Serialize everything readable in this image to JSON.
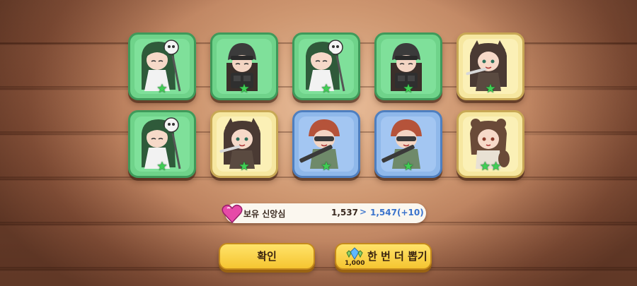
{
  "cards": [
    {
      "character": "skull-hat-girl",
      "frame": "green",
      "stars": "★"
    },
    {
      "character": "helmet-soldier",
      "frame": "green",
      "stars": "★"
    },
    {
      "character": "skull-hat-girl",
      "frame": "green",
      "stars": "★"
    },
    {
      "character": "helmet-soldier",
      "frame": "green",
      "stars": "★"
    },
    {
      "character": "wolf-girl",
      "frame": "yellow",
      "stars": "★"
    },
    {
      "character": "skull-hat-girl",
      "frame": "green",
      "stars": "★"
    },
    {
      "character": "wolf-girl",
      "frame": "yellow",
      "stars": "★"
    },
    {
      "character": "red-helmet-gunner",
      "frame": "blue",
      "stars": "★"
    },
    {
      "character": "red-helmet-gunner",
      "frame": "blue",
      "stars": "★"
    },
    {
      "character": "bear-girl",
      "frame": "yellow",
      "stars": "★★"
    }
  ],
  "belief": {
    "label": "보유 신앙심",
    "current": "1,537",
    "arrow": ">",
    "new_value": "1,547(+10)"
  },
  "buttons": {
    "confirm_label": "확인",
    "again_label": "한 번 더 뽑기",
    "again_cost": "1,000"
  },
  "colors": {
    "green_frame": "#6fd38a",
    "yellow_frame": "#f6e7a0",
    "blue_frame": "#8fb8ea",
    "button": "#f5c531"
  }
}
